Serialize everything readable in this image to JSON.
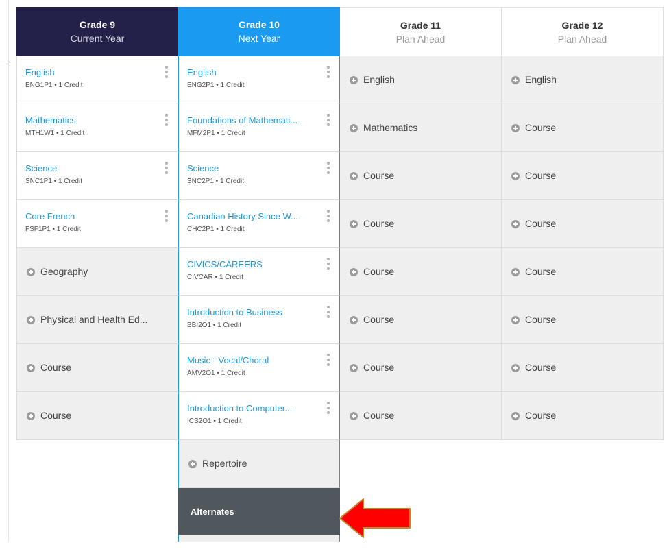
{
  "columns": [
    {
      "grade": "Grade 9",
      "subtitle": "Current Year",
      "cells": [
        {
          "kind": "course",
          "title": "English",
          "code": "ENG1P1 • 1 Credit"
        },
        {
          "kind": "course",
          "title": "Mathematics",
          "code": "MTH1W1 • 1 Credit"
        },
        {
          "kind": "course",
          "title": "Science",
          "code": "SNC1P1 • 1 Credit"
        },
        {
          "kind": "course",
          "title": "Core French",
          "code": "FSF1P1 • 1 Credit"
        },
        {
          "kind": "empty",
          "label": "Geography"
        },
        {
          "kind": "empty",
          "label": "Physical and Health Ed..."
        },
        {
          "kind": "empty",
          "label": "Course"
        },
        {
          "kind": "empty",
          "label": "Course"
        }
      ]
    },
    {
      "grade": "Grade 10",
      "subtitle": "Next Year",
      "cells": [
        {
          "kind": "course",
          "title": "English",
          "code": "ENG2P1 • 1 Credit"
        },
        {
          "kind": "course",
          "title": "Foundations of Mathemati...",
          "code": "MFM2P1 • 1 Credit"
        },
        {
          "kind": "course",
          "title": "Science",
          "code": "SNC2P1 • 1 Credit"
        },
        {
          "kind": "course",
          "title": "Canadian History Since W...",
          "code": "CHC2P1 • 1 Credit"
        },
        {
          "kind": "course",
          "title": "CIVICS/CAREERS",
          "code": "CIVCAR • 1 Credit"
        },
        {
          "kind": "course",
          "title": "Introduction to Business",
          "code": "BBI2O1 • 1 Credit"
        },
        {
          "kind": "course",
          "title": "Music - Vocal/Choral",
          "code": "AMV2O1 • 1 Credit"
        },
        {
          "kind": "course",
          "title": "Introduction to Computer...",
          "code": "ICS2O1 • 1 Credit"
        },
        {
          "kind": "empty",
          "label": "Repertoire"
        }
      ],
      "alternates_label": "Alternates"
    },
    {
      "grade": "Grade 11",
      "subtitle": "Plan Ahead",
      "cells": [
        {
          "kind": "empty",
          "label": "English"
        },
        {
          "kind": "empty",
          "label": "Mathematics"
        },
        {
          "kind": "empty",
          "label": "Course"
        },
        {
          "kind": "empty",
          "label": "Course"
        },
        {
          "kind": "empty",
          "label": "Course"
        },
        {
          "kind": "empty",
          "label": "Course"
        },
        {
          "kind": "empty",
          "label": "Course"
        },
        {
          "kind": "empty",
          "label": "Course"
        }
      ]
    },
    {
      "grade": "Grade 12",
      "subtitle": "Plan Ahead",
      "cells": [
        {
          "kind": "empty",
          "label": "English"
        },
        {
          "kind": "empty",
          "label": "Course"
        },
        {
          "kind": "empty",
          "label": "Course"
        },
        {
          "kind": "empty",
          "label": "Course"
        },
        {
          "kind": "empty",
          "label": "Course"
        },
        {
          "kind": "empty",
          "label": "Course"
        },
        {
          "kind": "empty",
          "label": "Course"
        },
        {
          "kind": "empty",
          "label": "Course"
        }
      ]
    }
  ],
  "colors": {
    "current_header": "#23214a",
    "next_header": "#1a9af0",
    "course_link": "#1e98de",
    "empty_cell": "#efefef",
    "alternates_bg": "#50575d",
    "annotation_arrow": "#ff0000"
  },
  "icons": {
    "add": "plus-circle-icon",
    "menu": "kebab-menu-icon",
    "annotation": "arrow-left-icon"
  }
}
